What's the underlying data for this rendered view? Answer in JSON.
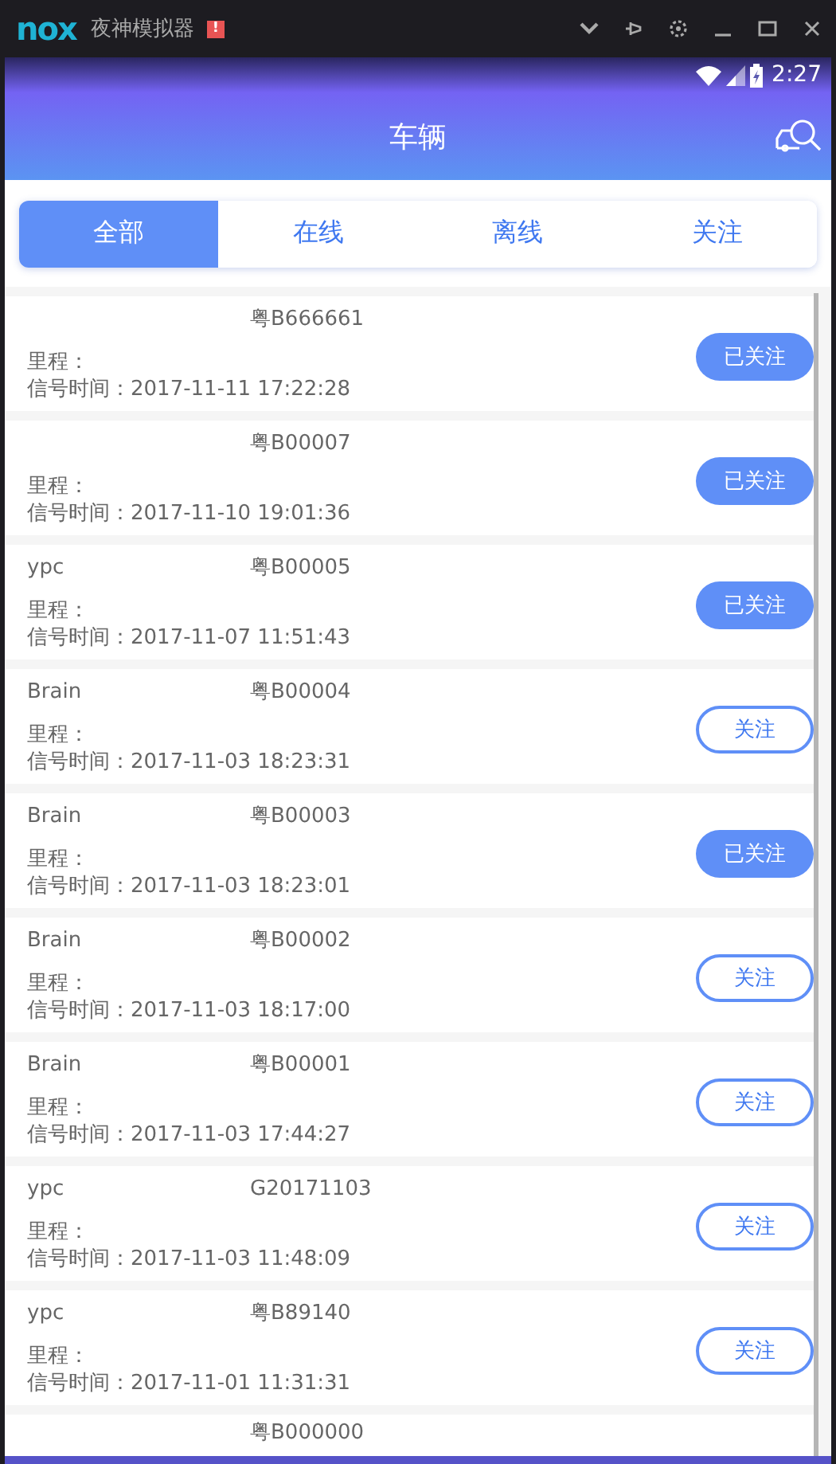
{
  "emulator": {
    "logo": "nox",
    "title": "夜神模拟器",
    "alert": "!"
  },
  "status_bar": {
    "time": "2:27"
  },
  "app_bar": {
    "title": "车辆"
  },
  "tabs": [
    {
      "label": "全部",
      "selected": true
    },
    {
      "label": "在线",
      "selected": false
    },
    {
      "label": "离线",
      "selected": false
    },
    {
      "label": "关注",
      "selected": false
    }
  ],
  "vehicles": [
    {
      "kind": "full",
      "plate": "粤B666661",
      "mileage": "里程：",
      "signal_time": "信号时间：2017-11-11 17:22:28",
      "button": "已关注",
      "followed": true
    },
    {
      "kind": "full",
      "plate": "粤B00007",
      "mileage": "里程：",
      "signal_time": "信号时间：2017-11-10 19:01:36",
      "button": "已关注",
      "followed": true
    },
    {
      "kind": "full",
      "owner": "ypc",
      "plate": "粤B00005",
      "mileage": "里程：",
      "signal_time": "信号时间：2017-11-07 11:51:43",
      "button": "已关注",
      "followed": true
    },
    {
      "kind": "full",
      "owner": "Brain",
      "plate": "粤B00004",
      "mileage": "里程：",
      "signal_time": "信号时间：2017-11-03 18:23:31",
      "button": "关注",
      "followed": false
    },
    {
      "kind": "full",
      "owner": "Brain",
      "plate": "粤B00003",
      "mileage": "里程：",
      "signal_time": "信号时间：2017-11-03 18:23:01",
      "button": "已关注",
      "followed": true
    },
    {
      "kind": "full",
      "owner": "Brain",
      "plate": "粤B00002",
      "mileage": "里程：",
      "signal_time": "信号时间：2017-11-03 18:17:00",
      "button": "关注",
      "followed": false
    },
    {
      "kind": "full",
      "owner": "Brain",
      "plate": "粤B00001",
      "mileage": "里程：",
      "signal_time": "信号时间：2017-11-03 17:44:27",
      "button": "关注",
      "followed": false
    },
    {
      "kind": "full",
      "owner": "ypc",
      "plate": "G20171103",
      "mileage": "里程：",
      "signal_time": "信号时间：2017-11-03 11:48:09",
      "button": "关注",
      "followed": false
    },
    {
      "kind": "full",
      "owner": "ypc",
      "plate": "粤B89140",
      "mileage": "里程：",
      "signal_time": "信号时间：2017-11-01 11:31:31",
      "button": "关注",
      "followed": false
    },
    {
      "kind": "partial",
      "plate": "粤B000000"
    }
  ]
}
